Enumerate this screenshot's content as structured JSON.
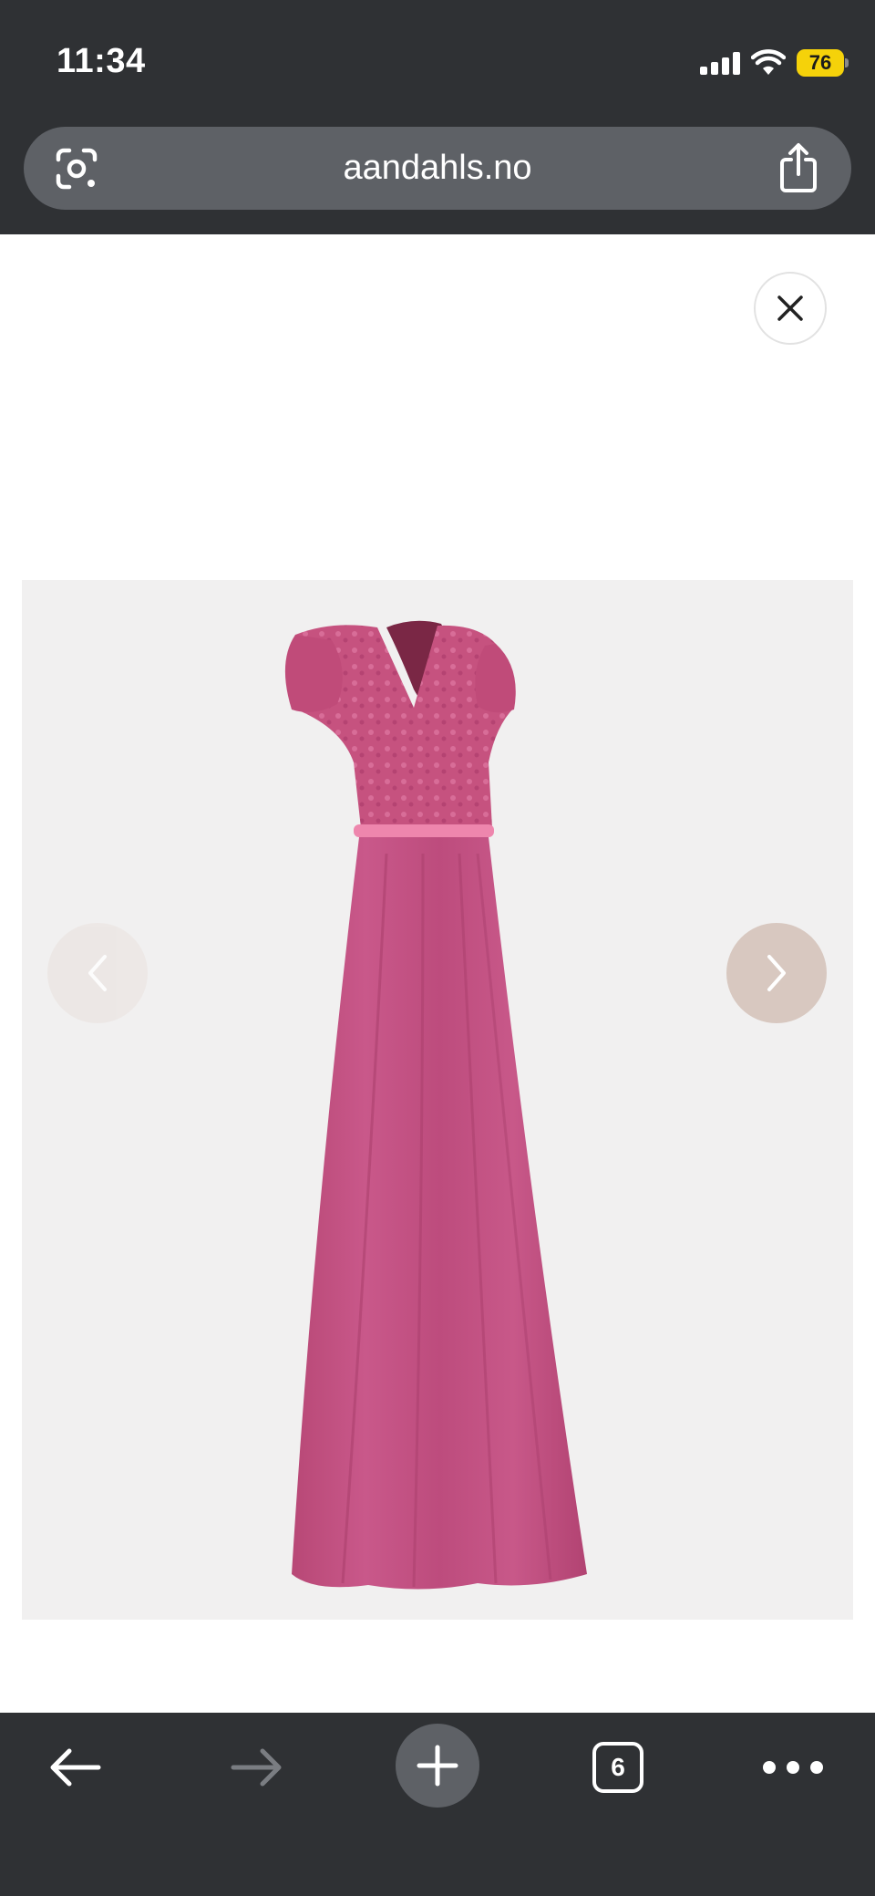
{
  "status_bar": {
    "time": "11:34",
    "battery_level": "76",
    "battery_color": "#f5d20a",
    "signal_icon": "cellular-signal-icon",
    "wifi_icon": "wifi-icon"
  },
  "browser": {
    "url": "aandahls.no",
    "lens_icon": "google-lens-icon",
    "share_icon": "share-icon",
    "chrome_color": "#2f3134",
    "url_bar_color": "#5e6166"
  },
  "gallery": {
    "close_icon": "close-icon",
    "prev_icon": "chevron-left-icon",
    "next_icon": "chevron-right-icon",
    "product_image": "pink-maxi-dress-lace-bodice",
    "product_color": "#c04f7e",
    "background_color": "#f1f0f0"
  },
  "toolbar": {
    "back_icon": "arrow-left-icon",
    "forward_icon": "arrow-right-icon",
    "new_tab_icon": "plus-icon",
    "tab_count": "6",
    "more_icon": "more-horizontal-icon"
  }
}
